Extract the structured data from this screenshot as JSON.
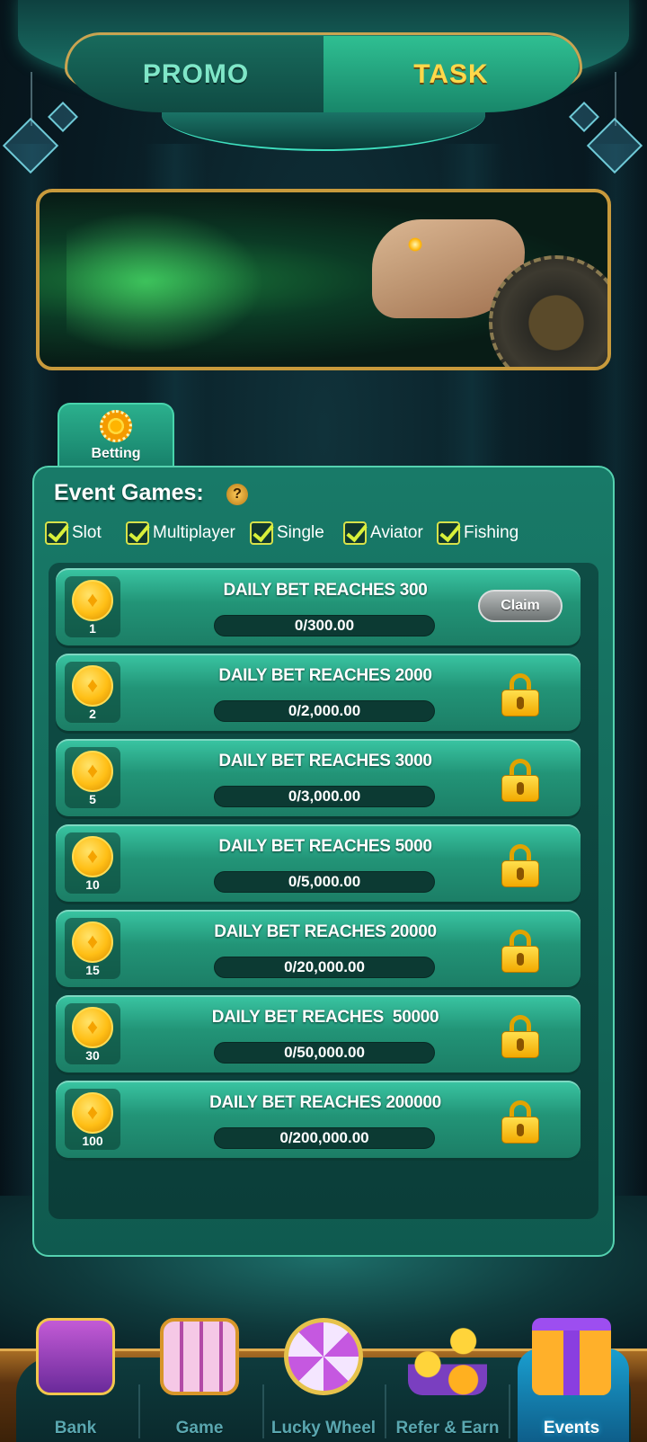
{
  "header": {
    "tabs": [
      {
        "label": "PROMO",
        "active": false
      },
      {
        "label": "TASK",
        "active": true
      }
    ]
  },
  "category_tab": {
    "label": "Betting",
    "icon": "poker-chip-icon"
  },
  "panel": {
    "title": "Event Games:",
    "help": "?",
    "games": [
      "Slot",
      "Multiplayer",
      "Single",
      "Aviator",
      "Fishing"
    ]
  },
  "tasks": [
    {
      "title": "DAILY BET REACHES 300",
      "reward": "1",
      "progress": "0/300.00",
      "progress_fraction": 0,
      "action": "Claim",
      "locked": false
    },
    {
      "title": "DAILY BET REACHES 2000",
      "reward": "2",
      "progress": "0/2,000.00",
      "progress_fraction": 0,
      "locked": true
    },
    {
      "title": "DAILY BET REACHES 3000",
      "reward": "5",
      "progress": "0/3,000.00",
      "progress_fraction": 0,
      "locked": true
    },
    {
      "title": "DAILY BET REACHES 5000",
      "reward": "10",
      "progress": "0/5,000.00",
      "progress_fraction": 0,
      "locked": true
    },
    {
      "title": "DAILY BET REACHES 20000",
      "reward": "15",
      "progress": "0/20,000.00",
      "progress_fraction": 0,
      "locked": true
    },
    {
      "title": "DAILY BET REACHES  50000",
      "reward": "30",
      "progress": "0/50,000.00",
      "progress_fraction": 0,
      "locked": true
    },
    {
      "title": "DAILY BET REACHES 200000",
      "reward": "100",
      "progress": "0/200,000.00",
      "progress_fraction": 0,
      "locked": true
    }
  ],
  "nav": [
    {
      "label": "Bank",
      "icon": "bank-icon",
      "active": false
    },
    {
      "label": "Game",
      "icon": "slot-machine-icon",
      "active": false
    },
    {
      "label": "Lucky Wheel",
      "icon": "lucky-wheel-icon",
      "active": false
    },
    {
      "label": "Refer & Earn",
      "icon": "share-icon",
      "active": false
    },
    {
      "label": "Events",
      "icon": "gift-icon",
      "active": true
    }
  ],
  "colors": {
    "accent": "#2bb08d",
    "gold": "#ffd22e",
    "active_tab_text": "#ffd84a",
    "nav_active": "#1a9fd0"
  }
}
